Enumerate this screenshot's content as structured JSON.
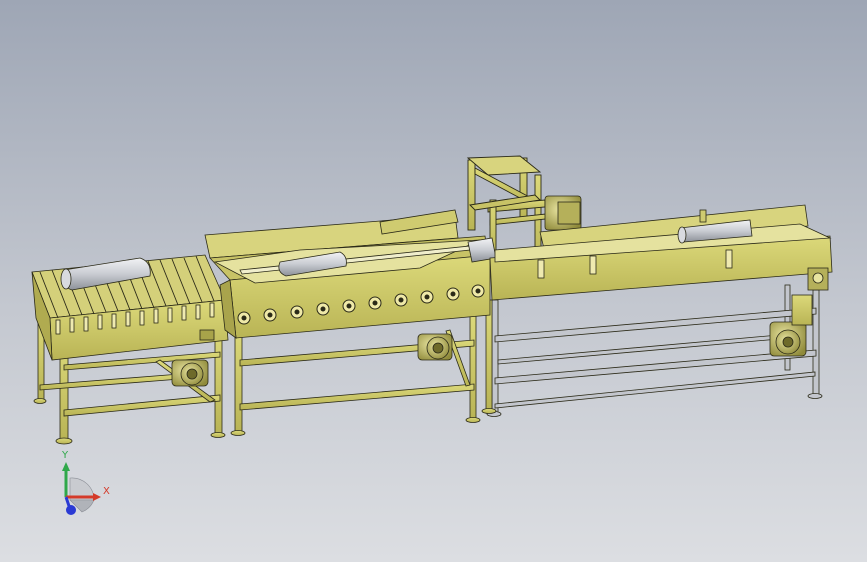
{
  "viewport": {
    "background_top": "#9ea6b5",
    "background_bottom": "#dcdee2"
  },
  "model": {
    "frame_color": "#cdc967",
    "frame_shade": "#a9a44c",
    "outline_color": "#2b2a18",
    "grey_frame_color": "#b9bcc4"
  },
  "triad": {
    "x_label": "X",
    "y_label": "Y",
    "x_color": "#d43a2a",
    "y_color": "#2fa84a",
    "z_color": "#2a3ad4"
  }
}
